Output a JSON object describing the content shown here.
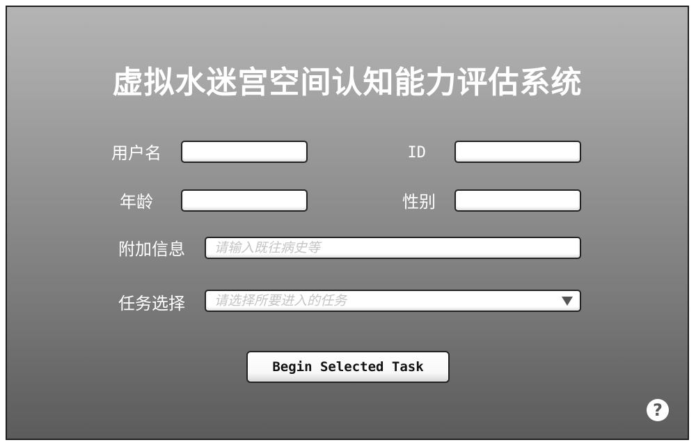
{
  "window": {
    "title": "虚拟水迷宫空间认知能力评估系统"
  },
  "form": {
    "username": {
      "label": "用户名",
      "value": "",
      "placeholder": ""
    },
    "id": {
      "label": "ID",
      "value": "",
      "placeholder": ""
    },
    "age": {
      "label": "年龄",
      "value": "",
      "placeholder": ""
    },
    "gender": {
      "label": "性别",
      "value": "",
      "placeholder": ""
    },
    "additional_info": {
      "label": "附加信息",
      "value": "",
      "placeholder": "请输入既往病史等"
    },
    "task_select": {
      "label": "任务选择",
      "selected": "",
      "placeholder": "请选择所要进入的任务",
      "icon": "triangle-down-icon"
    }
  },
  "actions": {
    "begin_label": "Begin Selected Task",
    "help_label": "?",
    "help_icon": "question-circle-icon"
  }
}
